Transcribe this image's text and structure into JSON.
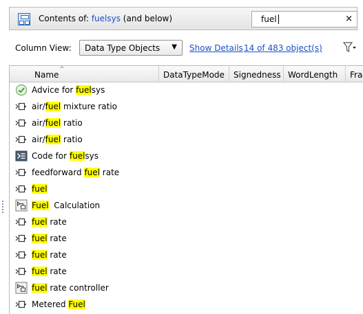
{
  "contents_bar": {
    "prefix": "Contents of:",
    "scope": "fuelsys",
    "suffix": "(and below)",
    "search_value": "fuel",
    "clear_glyph": "×"
  },
  "toolbar": {
    "column_view_label": "Column View:",
    "column_view_value": "Data Type Objects",
    "show_details": "Show Details",
    "object_count": "14 of 483 object(s)"
  },
  "columns": [
    "Name",
    "DataTypeMode",
    "Signedness",
    "WordLength",
    "Fract"
  ],
  "rows": [
    {
      "icon": "check-circle-icon",
      "parts": [
        {
          "t": "Advice for "
        },
        {
          "t": "fuel",
          "h": true
        },
        {
          "t": "sys"
        }
      ]
    },
    {
      "icon": "signal-icon",
      "parts": [
        {
          "t": "air/"
        },
        {
          "t": "fuel",
          "h": true
        },
        {
          "t": " mixture ratio"
        }
      ]
    },
    {
      "icon": "signal-icon",
      "parts": [
        {
          "t": "air/"
        },
        {
          "t": "fuel",
          "h": true
        },
        {
          "t": " ratio"
        }
      ]
    },
    {
      "icon": "signal-icon",
      "parts": [
        {
          "t": "air/"
        },
        {
          "t": "fuel",
          "h": true
        },
        {
          "t": " ratio"
        }
      ]
    },
    {
      "icon": "code-icon",
      "parts": [
        {
          "t": "Code for "
        },
        {
          "t": "fuel",
          "h": true
        },
        {
          "t": "sys"
        }
      ]
    },
    {
      "icon": "signal-icon",
      "parts": [
        {
          "t": "feedforward "
        },
        {
          "t": "fuel",
          "h": true
        },
        {
          "t": " rate"
        }
      ]
    },
    {
      "icon": "signal-icon",
      "parts": [
        {
          "t": "fuel",
          "h": true
        }
      ]
    },
    {
      "icon": "subsystem-icon",
      "parts": [
        {
          "t": "Fuel",
          "h": true
        },
        {
          "t": "  Calculation"
        }
      ]
    },
    {
      "icon": "signal-icon",
      "parts": [
        {
          "t": "fuel",
          "h": true
        },
        {
          "t": " rate"
        }
      ]
    },
    {
      "icon": "signal-icon",
      "parts": [
        {
          "t": "fuel",
          "h": true
        },
        {
          "t": " rate"
        }
      ]
    },
    {
      "icon": "signal-icon",
      "parts": [
        {
          "t": "fuel",
          "h": true
        },
        {
          "t": " rate"
        }
      ]
    },
    {
      "icon": "signal-icon",
      "parts": [
        {
          "t": "fuel",
          "h": true
        },
        {
          "t": " rate"
        }
      ]
    },
    {
      "icon": "subsystem-icon",
      "parts": [
        {
          "t": "fuel",
          "h": true
        },
        {
          "t": " rate controller"
        }
      ]
    },
    {
      "icon": "signal-icon",
      "parts": [
        {
          "t": "Metered "
        },
        {
          "t": "Fuel",
          "h": true
        }
      ]
    }
  ],
  "colors": {
    "highlight": "#ffff00",
    "link": "#1a4fc4"
  }
}
